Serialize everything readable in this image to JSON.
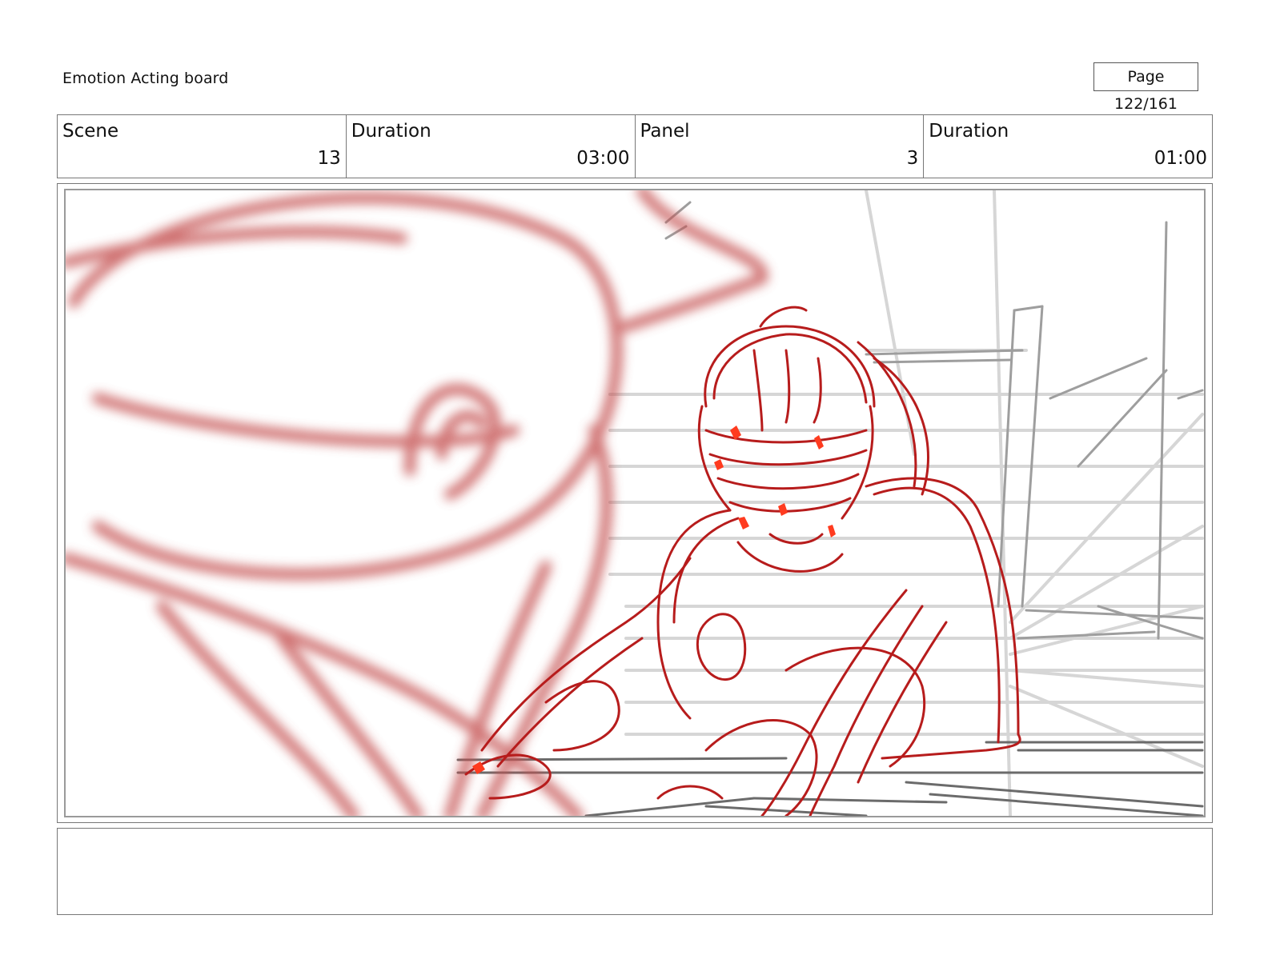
{
  "header": {
    "title": "Emotion Acting board",
    "page_label": "Page 122/161"
  },
  "info": {
    "scene_label": "Scene",
    "scene_value": "13",
    "scene_duration_label": "Duration",
    "scene_duration_value": "03:00",
    "panel_label": "Panel",
    "panel_value": "3",
    "panel_duration_label": "Duration",
    "panel_duration_value": "01:00"
  },
  "panel": {
    "description": "",
    "colors": {
      "sketch_red": "#b71c1c",
      "accent_red": "#ff3b1f",
      "blur_red": "#c45050",
      "pencil_gray": "#9e9e9e",
      "light_gray": "#d6d6d6"
    }
  },
  "notes": {
    "text": ""
  }
}
